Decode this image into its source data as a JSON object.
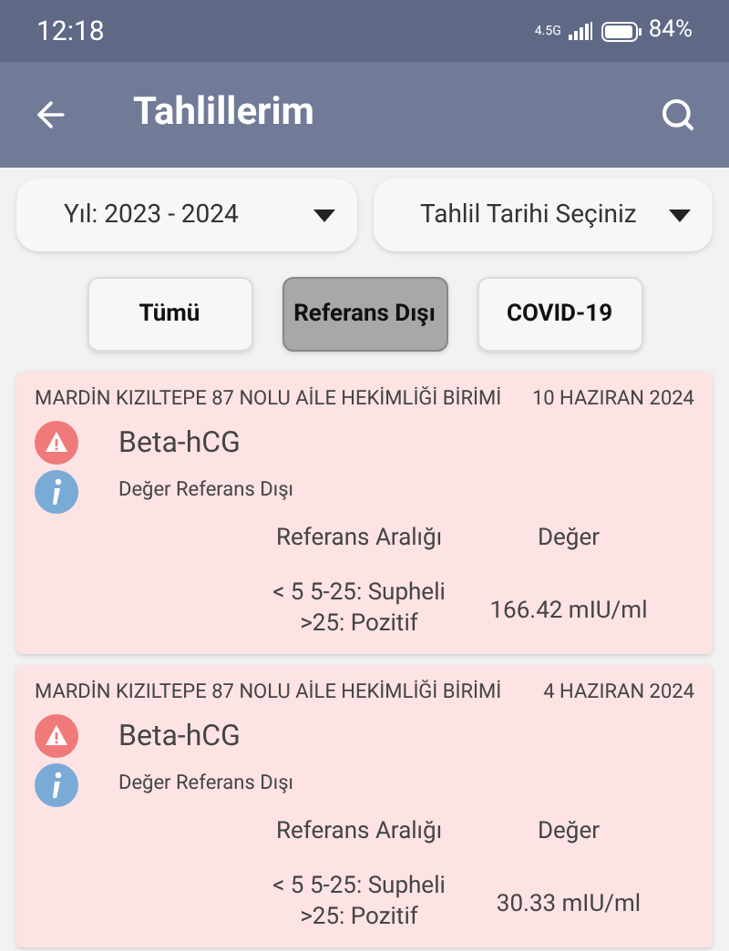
{
  "status_bar": {
    "time": "12:18",
    "network": "4.5G",
    "battery": "84%"
  },
  "app_bar": {
    "title": "Tahlillerim"
  },
  "filters": [
    {
      "label": "Yıl: 2023 - 2024"
    },
    {
      "label": "Tahlil Tarihi Seçiniz"
    }
  ],
  "tabs": [
    {
      "label": "Tümü",
      "selected": false
    },
    {
      "label": "Referans Dışı",
      "selected": true
    },
    {
      "label": "COVID-19",
      "selected": false
    }
  ],
  "results": [
    {
      "institution": "MARDİN KIZILTEPE 87 NOLU AİLE HEKİMLİĞİ BİRİMİ",
      "date": "10 HAZIRAN 2024",
      "test": "Beta-hCG",
      "status": "Değer Referans Dışı",
      "range_header": "Referans Aralığı",
      "value_header": "Değer",
      "range_lines": [
        "< 5 5-25: Supheli",
        ">25: Pozitif"
      ],
      "value": "166.42 mIU/ml"
    },
    {
      "institution": "MARDİN KIZILTEPE 87 NOLU AİLE HEKİMLİĞİ BİRİMİ",
      "date": "4 HAZIRAN 2024",
      "test": "Beta-hCG",
      "status": "Değer Referans Dışı",
      "range_header": "Referans Aralığı",
      "value_header": "Değer",
      "range_lines": [
        "< 5 5-25: Supheli",
        ">25: Pozitif"
      ],
      "value": "30.33 mIU/ml"
    }
  ]
}
